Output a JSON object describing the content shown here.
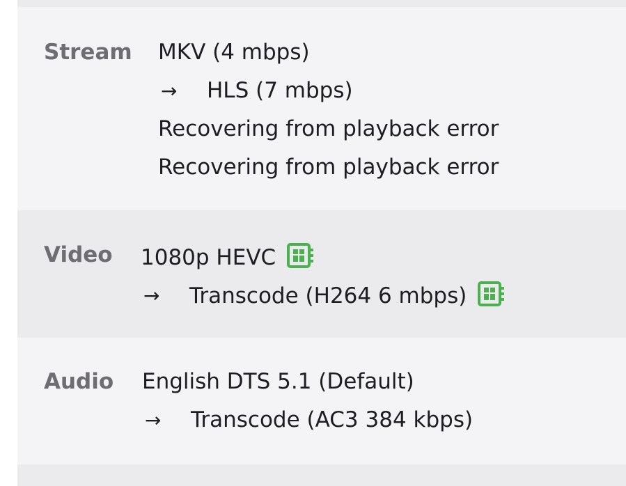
{
  "stream": {
    "label": "Stream",
    "source": "MKV (4 mbps)",
    "arrow": "→",
    "target": "HLS (7 mbps)",
    "messages": [
      "Recovering from playback error",
      "Recovering from playback error"
    ]
  },
  "video": {
    "label": "Video",
    "source": "1080p HEVC",
    "arrow": "→",
    "target": "Transcode (H264 6 mbps)",
    "source_icon": "hardware-accel-icon",
    "target_icon": "hardware-accel-icon"
  },
  "audio": {
    "label": "Audio",
    "source": "English DTS 5.1 (Default)",
    "arrow": "→",
    "target": "Transcode (AC3 384 kbps)"
  },
  "colors": {
    "label_gray": "#6e6e72",
    "text_dark": "#1e1e22",
    "icon_green": "#4caf50",
    "band_light": "#f4f4f7",
    "band_dark": "#ebebee"
  }
}
